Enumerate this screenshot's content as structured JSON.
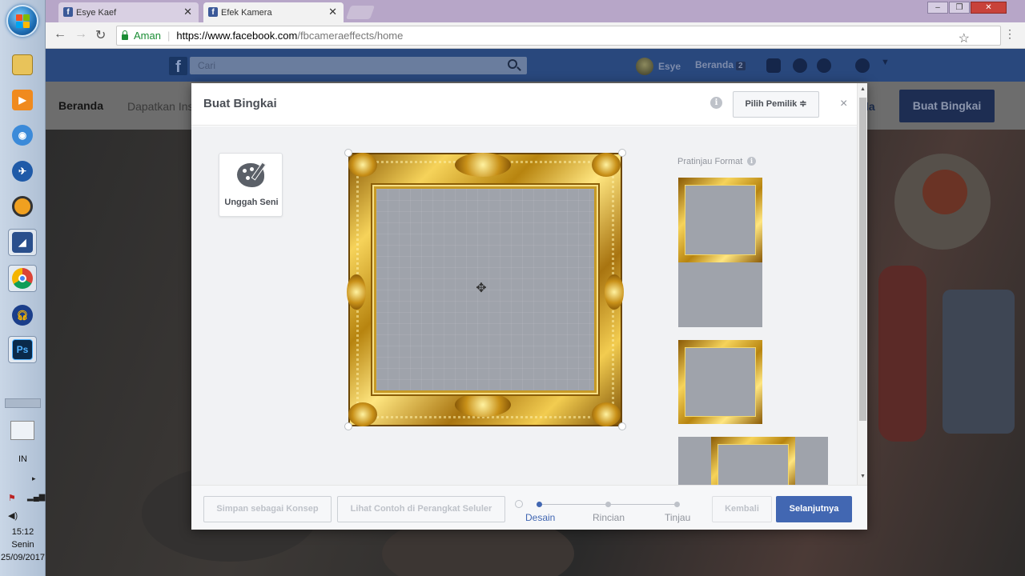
{
  "taskbar": {
    "apps": [
      "windows-explorer",
      "media-player",
      "network-app",
      "orbital-app",
      "pressure-app",
      "vpn-app",
      "chrome",
      "audio-app",
      "photoshop"
    ],
    "photoshop_label": "Ps",
    "language": "IN",
    "clock_time": "15:12",
    "clock_day": "Senin",
    "clock_date": "25/09/2017"
  },
  "browser": {
    "tabs": [
      {
        "title": "Esye Kaef",
        "active": false
      },
      {
        "title": "Efek Kamera",
        "active": true
      }
    ],
    "secure_label": "Aman",
    "url_host": "https://www.facebook.com",
    "url_path": "/fbcameraeffects/home"
  },
  "facebook": {
    "logo": "f",
    "search_placeholder": "Cari",
    "user_name": "Esye",
    "home_label": "Beranda",
    "home_count": "2",
    "subnav": {
      "home": "Beranda",
      "link": "Dapatkan Ins",
      "right_fragment": "la",
      "cta": "Buat Bingkai"
    }
  },
  "modal": {
    "title": "Buat Bingkai",
    "owner_button": "Pilih Pemilik ≑",
    "close": "×",
    "upload_label": "Unggah Seni",
    "preview_title": "Pratinjau Format",
    "info_glyph": "i",
    "footer": {
      "save_draft": "Simpan sebagai Konsep",
      "mobile_preview": "Lihat Contoh di Perangkat Seluler",
      "steps": [
        {
          "label": "Desain",
          "active": true
        },
        {
          "label": "Rincian",
          "active": false
        },
        {
          "label": "Tinjau",
          "active": false
        }
      ],
      "back": "Kembali",
      "next": "Selanjutnya"
    }
  },
  "colors": {
    "fb_blue": "#29487d",
    "accent": "#4267b2",
    "gold": "#d4a52a"
  }
}
